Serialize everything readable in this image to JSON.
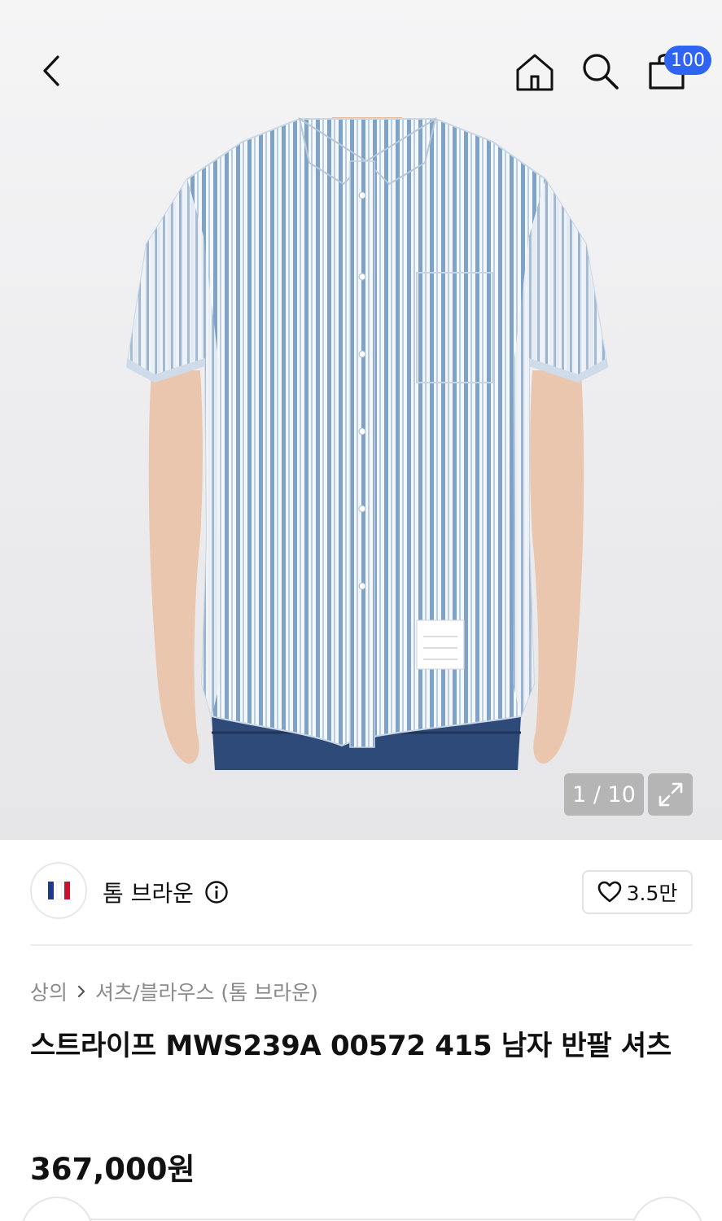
{
  "header": {
    "icons": [
      "chevron-left-icon",
      "home-icon",
      "search-icon",
      "shopping-bag-icon"
    ],
    "cart_badge": "100"
  },
  "gallery": {
    "pager": "1 / 10",
    "expand_icon": "expand-icon"
  },
  "brand": {
    "name": "톰 브라운",
    "logo_colors": [
      "#1f3a8a",
      "#ffffff",
      "#c4122f"
    ],
    "info_icon": "info-icon",
    "like_count": "3.5만",
    "like_icon": "heart-outline-icon"
  },
  "breadcrumb": {
    "items": [
      "상의",
      "셔츠/블라우스 (톰 브라운)"
    ],
    "separator": "›"
  },
  "product": {
    "title": "스트라이프 MWS239A 00572 415 남자 반팔 셔츠",
    "price": "367,000원"
  },
  "colors": {
    "badge": "#2f63f1",
    "text": "#111111",
    "muted": "#8a8a8a"
  }
}
